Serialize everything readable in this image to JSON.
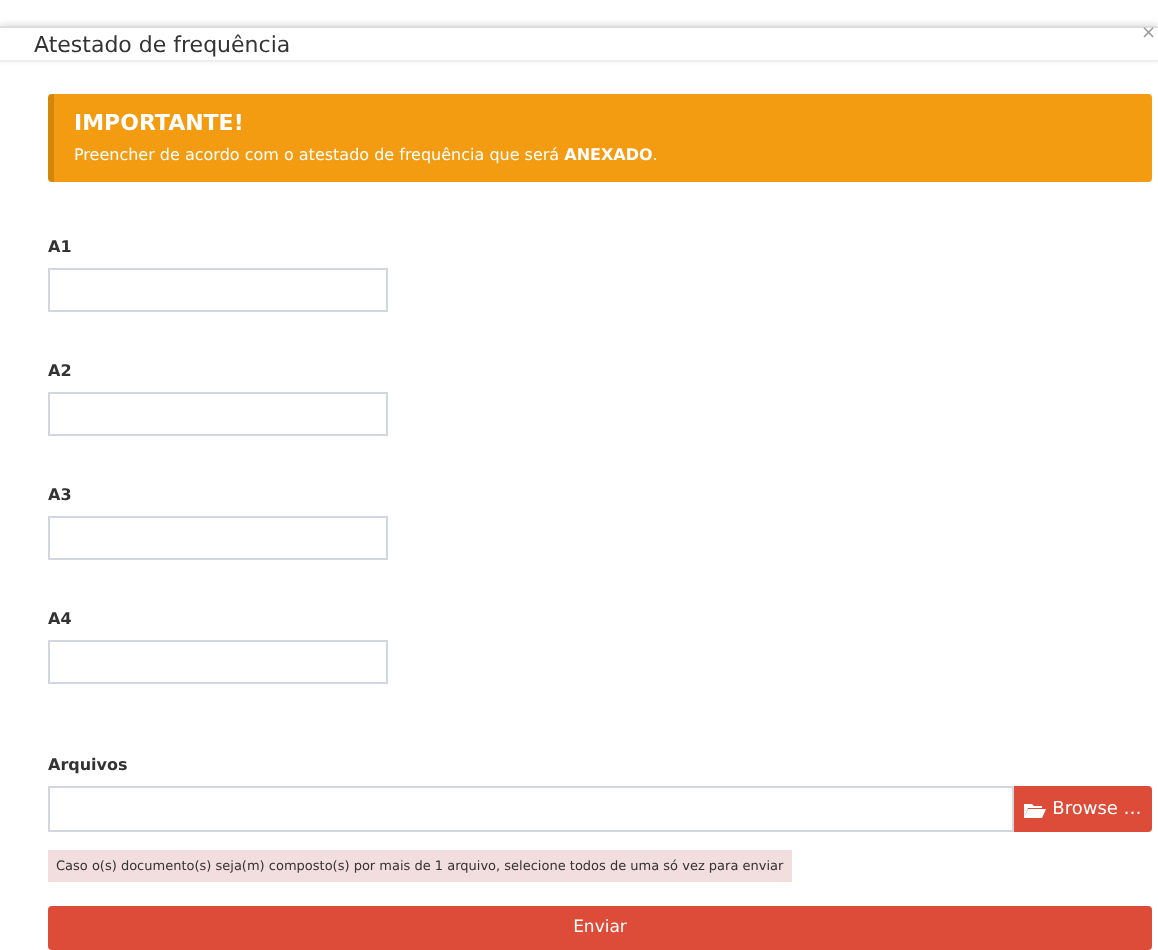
{
  "modal": {
    "title": "Atestado de frequência",
    "close": "×"
  },
  "alert": {
    "heading": "IMPORTANTE!",
    "text": "Preencher de acordo com o atestado de frequência que será **ANEXADO**."
  },
  "fields": [
    {
      "label": "A1"
    },
    {
      "label": "A2"
    },
    {
      "label": "A3"
    },
    {
      "label": "A4"
    }
  ],
  "files": {
    "label": "Arquivos",
    "button": "Browse …",
    "note": "Caso o(s) documento(s) seja(m) composto(s) por mais de 1 arquivo, selecione todos de uma só vez para enviar"
  },
  "submit": "Enviar"
}
